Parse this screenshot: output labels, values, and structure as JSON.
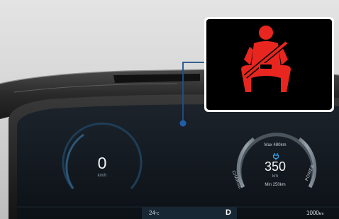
{
  "cluster": {
    "speed": {
      "value": "0",
      "unit": "km/h"
    },
    "range": {
      "max_label": "Max 480km",
      "value": "350",
      "unit": "km",
      "min_label": "Min 250km",
      "charge_label": "CHARGE",
      "power_label": "POWER"
    },
    "status_bar": {
      "outside_temp": "24",
      "temp_unit": "°C",
      "gear": "D",
      "odometer": "1000",
      "odometer_unit": "km"
    }
  },
  "warning_callout": {
    "icon": "seatbelt-warning-icon",
    "icon_color": "#e8261f",
    "panel_color": "#000000"
  },
  "colors": {
    "gauge_ring": "#1c3a52",
    "charge_indicator": "#3aa0e8",
    "leader_line": "#1f4f8a"
  }
}
